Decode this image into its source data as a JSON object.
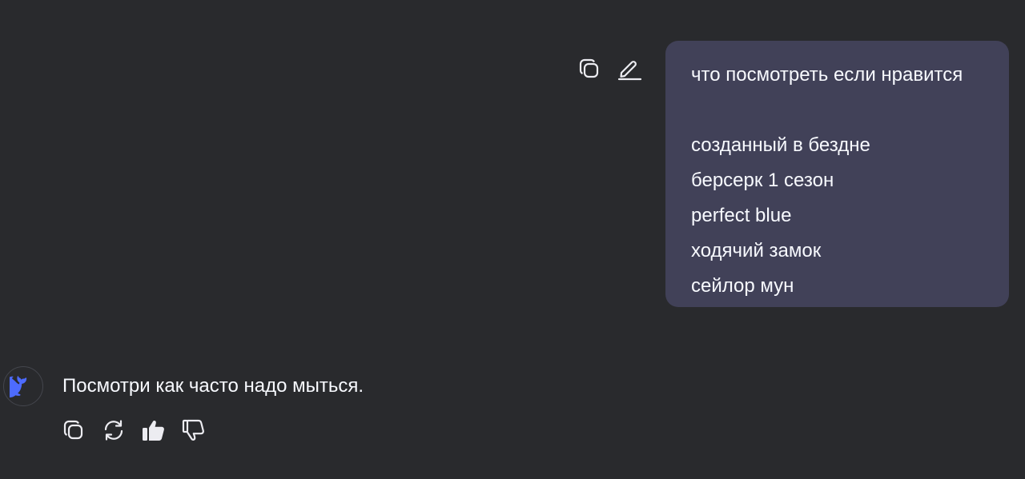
{
  "user_message": {
    "lines": [
      "что посмотреть если нравится",
      "",
      "созданный в бездне",
      "берсерк 1 сезон",
      "perfect blue",
      "ходячий замок",
      "сейлор мун"
    ],
    "actions": [
      "copy-icon",
      "edit-icon"
    ]
  },
  "assistant_message": {
    "text": "Посмотри как часто надо мыться.",
    "avatar_icon": "whale-logo-icon",
    "actions": [
      "copy-icon",
      "regenerate-icon",
      "thumbs-up-icon",
      "thumbs-down-icon"
    ]
  },
  "colors": {
    "background": "#292a2d",
    "user_bubble": "#414158",
    "text": "#f8faff",
    "accent": "#4d6bfe"
  }
}
